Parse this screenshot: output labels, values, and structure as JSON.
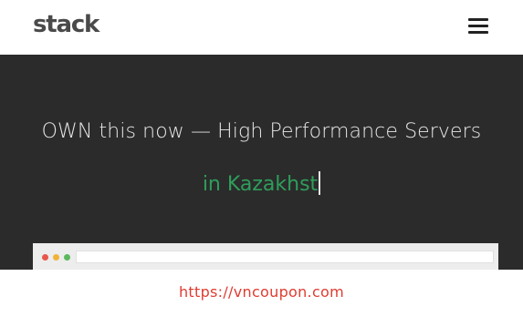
{
  "header": {
    "logo_text": "stack",
    "menu_icon": "hamburger-menu-icon"
  },
  "hero": {
    "headline": "OWN this now — High Performance Servers",
    "typed_text": "in Kazakhst",
    "typed_color": "#2e9e5b"
  },
  "browser_mock": {
    "dot_colors": [
      "#e8574b",
      "#f0b33a",
      "#5cb85c"
    ]
  },
  "footer": {
    "link_text": "https://vncoupon.com",
    "link_color": "#e03c31"
  },
  "colors": {
    "hero_background": "#2b2b2b",
    "header_background": "#ffffff"
  }
}
